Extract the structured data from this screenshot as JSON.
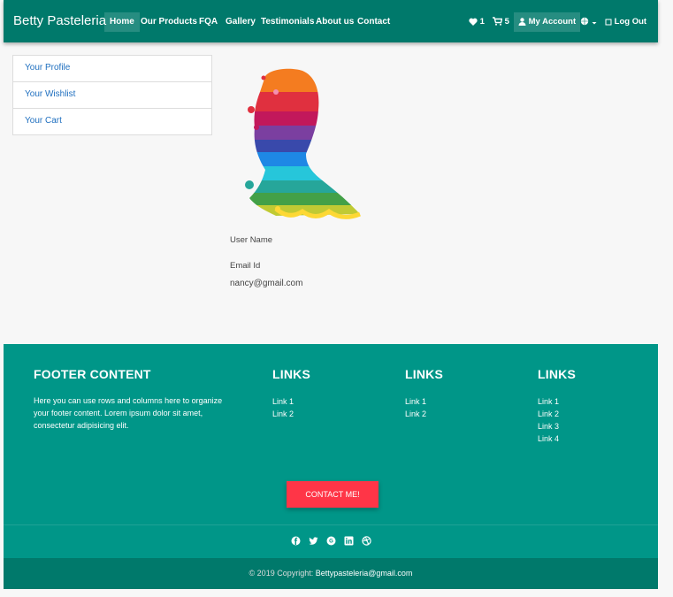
{
  "brand": "Betty Pasteleria",
  "nav": {
    "home": "Home",
    "products": "Our Products",
    "fqa": "FQA",
    "gallery": "Gallery",
    "testimonials": "Testimonials",
    "about": "About us",
    "contact": "Contact",
    "wishlist_count": "1",
    "cart_count": "5",
    "account": "My Account",
    "logout": "Log Out"
  },
  "sidebar": {
    "items": [
      {
        "label": "Your Profile"
      },
      {
        "label": "Your Wishlist"
      },
      {
        "label": "Your Cart"
      }
    ]
  },
  "profile": {
    "username_label": "User Name",
    "username_value": "",
    "email_label": "Email Id",
    "email_value": "nancy@gmail.com"
  },
  "footer": {
    "content_title": "FOOTER CONTENT",
    "content_text": "Here you can use rows and columns here to organize your footer content. Lorem ipsum dolor sit amet, consectetur adipisicing elit.",
    "columns": [
      {
        "title": "LINKS",
        "links": [
          "Link 1",
          "Link 2"
        ]
      },
      {
        "title": "LINKS",
        "links": [
          "Link 1",
          "Link 2"
        ]
      },
      {
        "title": "LINKS",
        "links": [
          "Link 1",
          "Link 2",
          "Link 3",
          "Link 4"
        ]
      }
    ],
    "contact_button": "CONTACT ME!",
    "social_icons": [
      "facebook-icon",
      "twitter-icon",
      "google-plus-icon",
      "linkedin-icon",
      "dribbble-icon"
    ],
    "copyright_prefix": "© 2019 Copyright:",
    "copyright_email": "Bettypasteleria@gmail.com"
  },
  "colors": {
    "navbar": "#00796b",
    "footer": "#009688",
    "button": "#ff3547"
  }
}
